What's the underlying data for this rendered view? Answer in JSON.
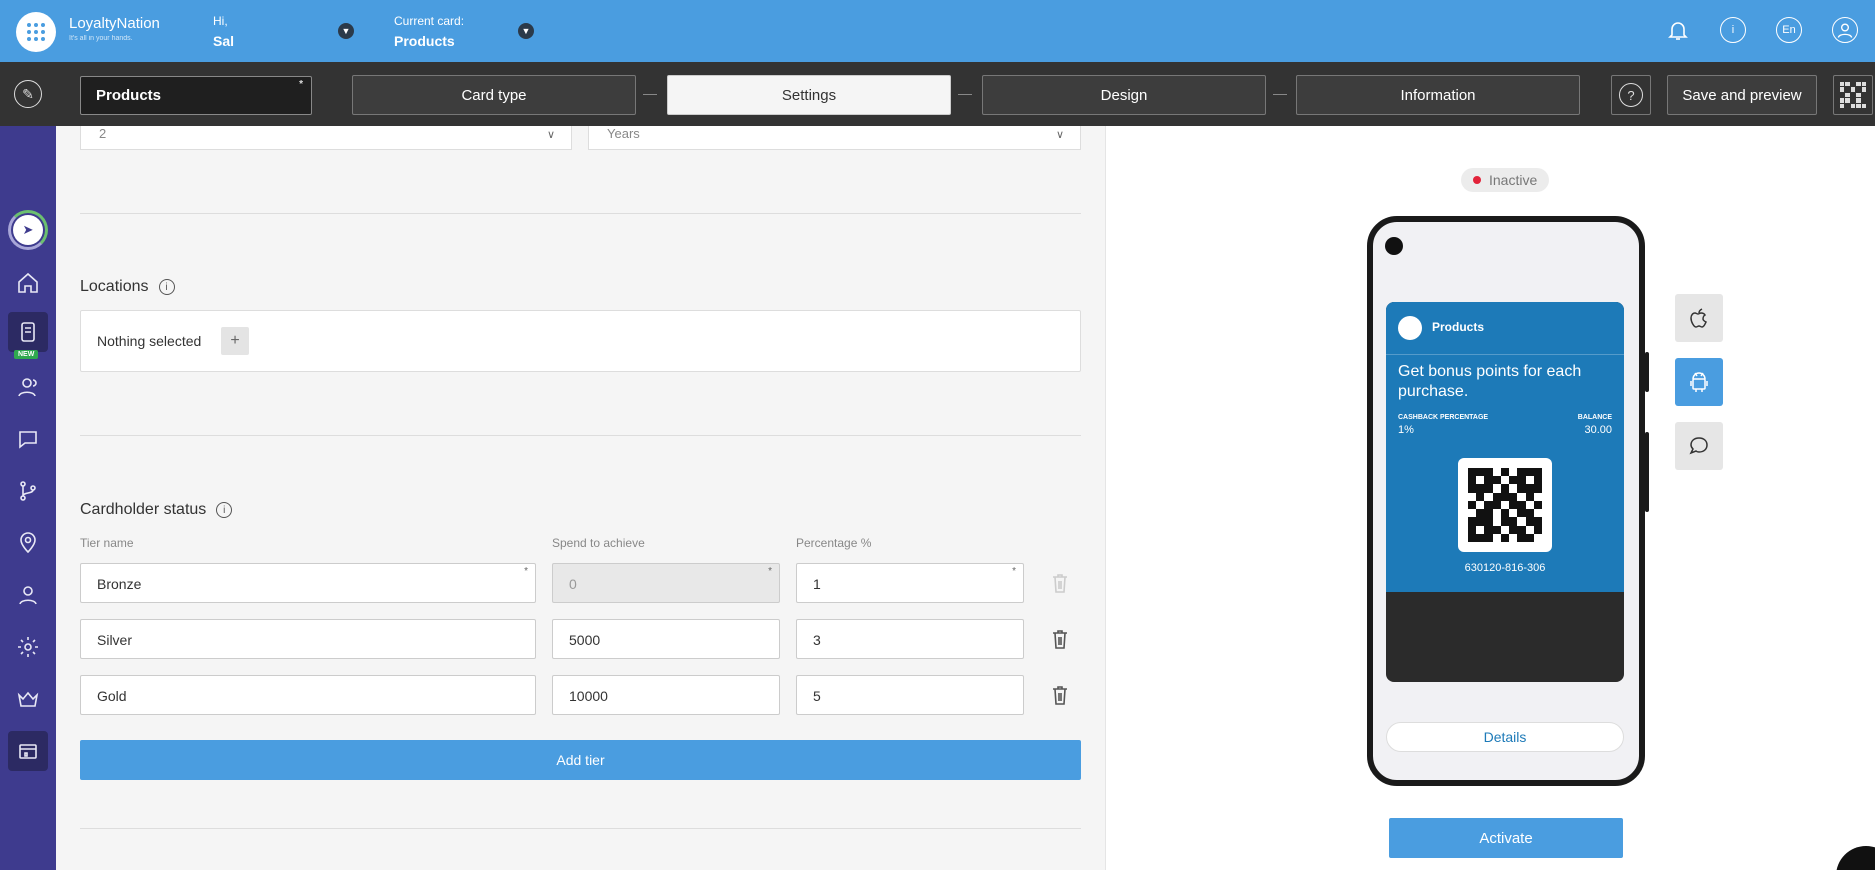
{
  "app": {
    "brand": "LoyaltyNation",
    "tagline": "It's all in your hands.",
    "greeting_label": "Hi,",
    "user_name": "Sal",
    "current_card_label": "Current card:",
    "current_card_name": "Products",
    "language": "En"
  },
  "toolbar": {
    "card_name": "Products",
    "required_mark": "*",
    "steps": [
      "Card type",
      "Settings",
      "Design",
      "Information"
    ],
    "active_step": "Settings",
    "help_label": "?",
    "save_label": "Save and preview"
  },
  "sidebar": {
    "new_badge": "NEW",
    "items": [
      "rocket-icon",
      "home-icon",
      "card-icon",
      "users-icon",
      "chat-icon",
      "flow-icon",
      "location-icon",
      "user-icon",
      "settings-icon",
      "crown-icon",
      "shop-icon"
    ]
  },
  "form": {
    "expiry_value": "2",
    "expiry_unit": "Years",
    "locations_title": "Locations",
    "locations_value": "Nothing selected",
    "cardholder_title": "Cardholder status",
    "columns": [
      "Tier name",
      "Spend to achieve",
      "Percentage %"
    ],
    "tiers": [
      {
        "name": "Bronze",
        "spend": "0",
        "percent": "1"
      },
      {
        "name": "Silver",
        "spend": "5000",
        "percent": "3"
      },
      {
        "name": "Gold",
        "spend": "10000",
        "percent": "5"
      }
    ],
    "add_tier_label": "Add tier"
  },
  "preview": {
    "status": "Inactive",
    "card_title": "Products",
    "headline": "Get bonus points for each purchase.",
    "left_field_label": "CASHBACK PERCENTAGE",
    "left_field_value": "1%",
    "right_field_label": "BALANCE",
    "right_field_value": "30.00",
    "code": "630120-816-306",
    "details_label": "Details",
    "activate_label": "Activate",
    "platforms": [
      "apple-icon",
      "android-icon",
      "message-icon"
    ],
    "active_platform": "android-icon"
  },
  "colors": {
    "primary": "#4a9de0",
    "toolbar": "#333333",
    "sidebar": "#3e3b8e",
    "wallet": "#1d7ab8",
    "inactive_dot": "#e2233a",
    "new_badge": "#2fa84f"
  }
}
